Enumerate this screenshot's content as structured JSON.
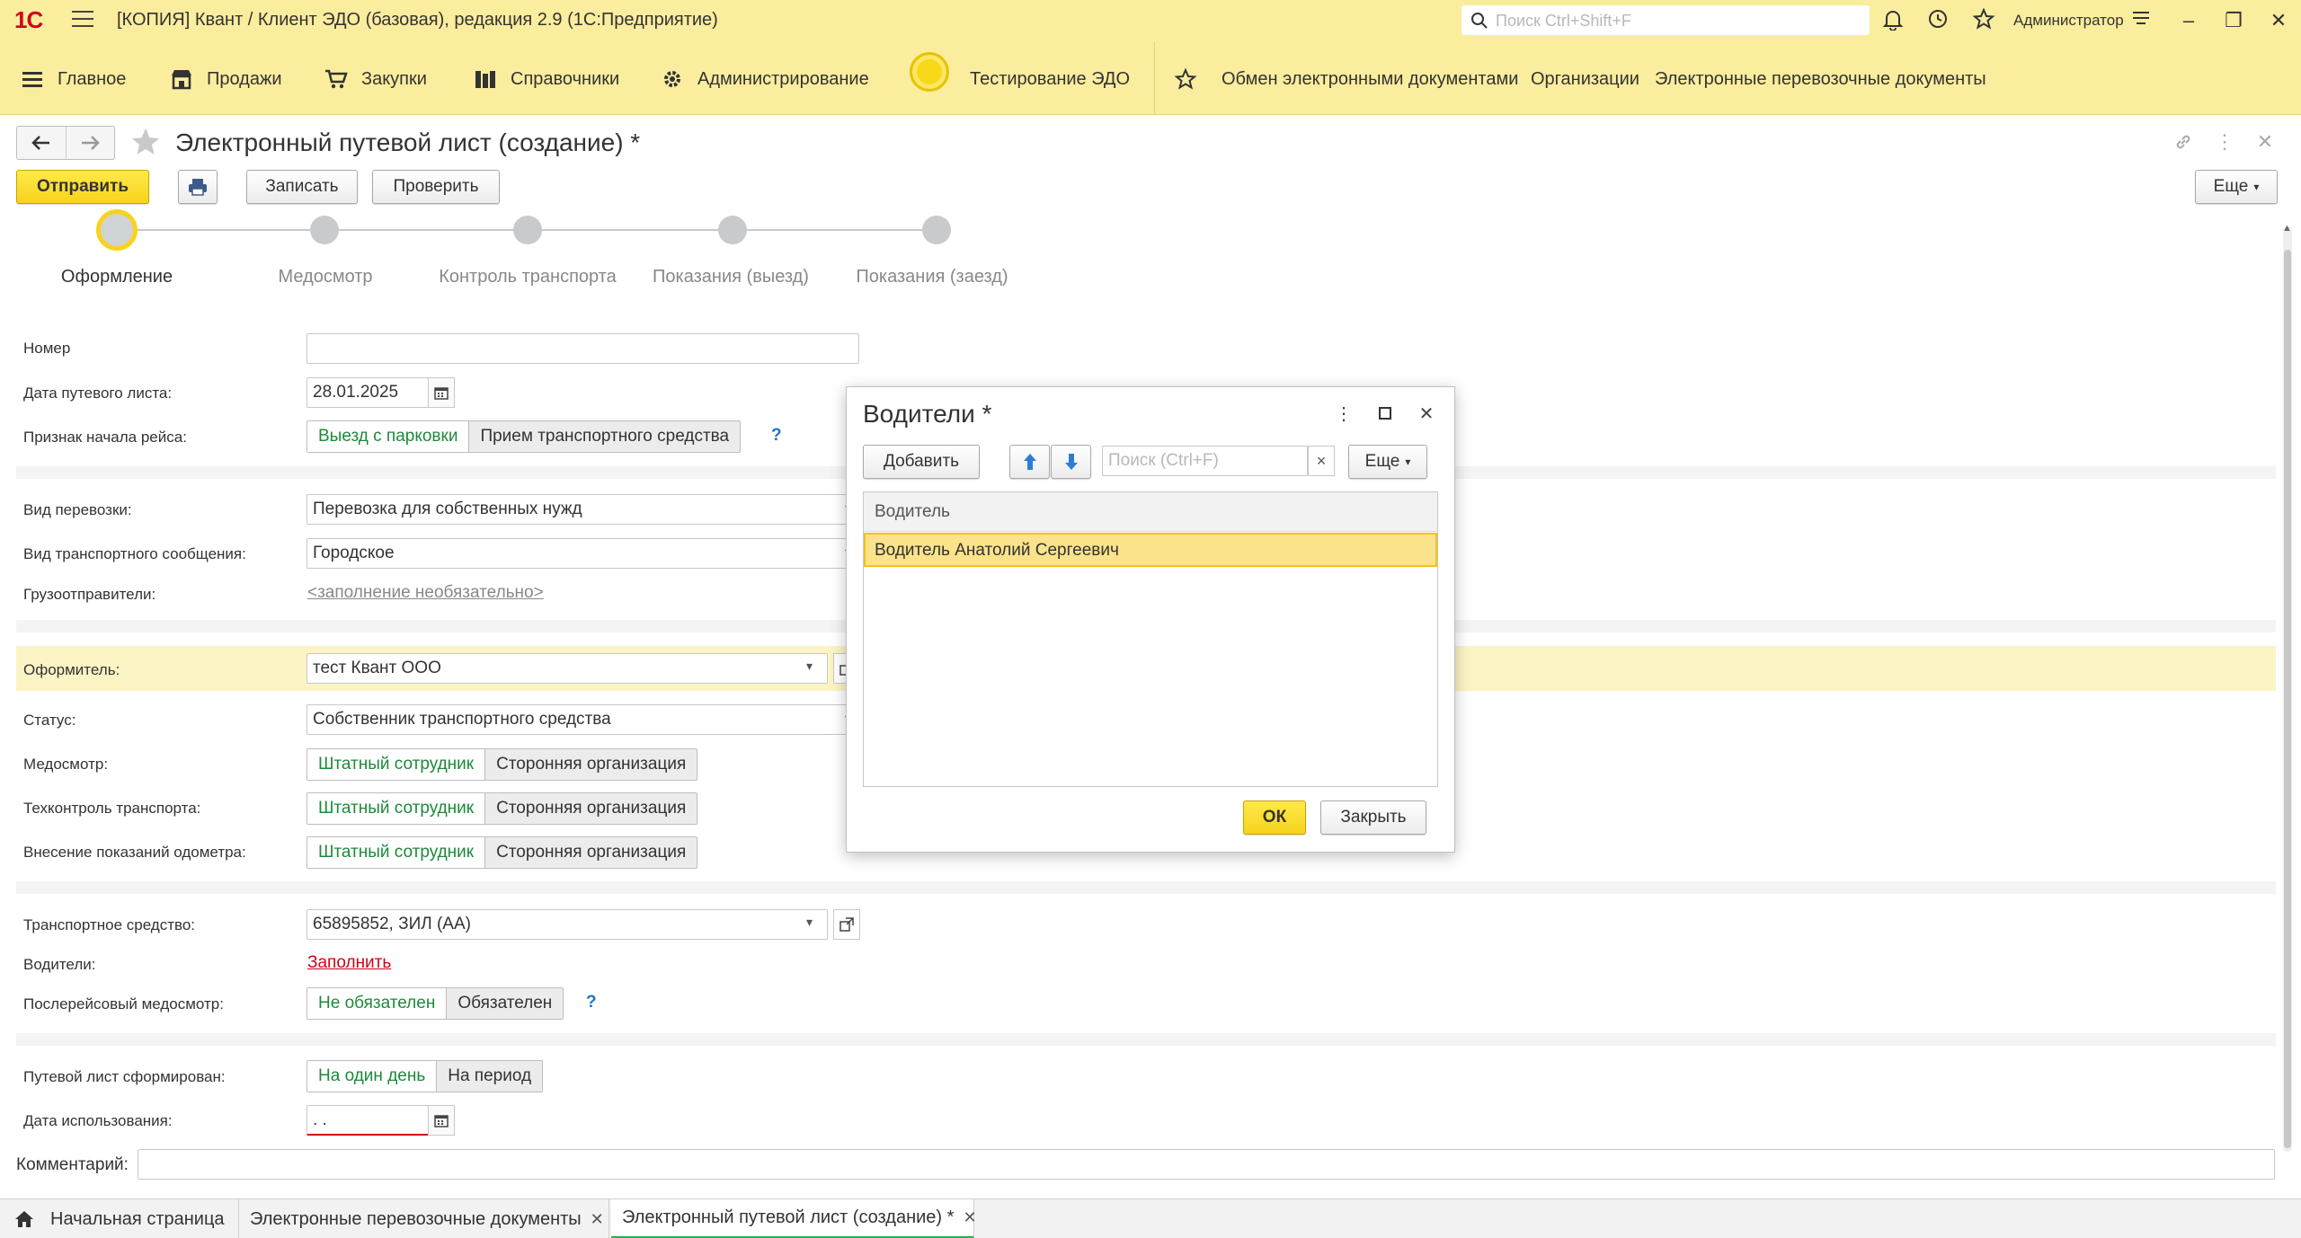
{
  "window": {
    "logo": "1C",
    "title": "[КОПИЯ] Квант / Клиент ЭДО (базовая), редакция 2.9  (1С:Предприятие)",
    "search_placeholder": "Поиск Ctrl+Shift+F",
    "user": "Администратор"
  },
  "menu": {
    "items": [
      {
        "label": "Главное",
        "icon": "hamburger-icon"
      },
      {
        "label": "Продажи",
        "icon": "shop-icon"
      },
      {
        "label": "Закупки",
        "icon": "cart-icon"
      },
      {
        "label": "Справочники",
        "icon": "books-icon"
      },
      {
        "label": "Администрирование",
        "icon": "gear-icon"
      },
      {
        "label": "Тестирование ЭДО",
        "icon": "sun-icon"
      }
    ],
    "favorites": [
      "Обмен электронными документами",
      "Организации",
      "Электронные перевозочные документы"
    ]
  },
  "form": {
    "title": "Электронный путевой лист (создание) *",
    "buttons": {
      "send": "Отправить",
      "save": "Записать",
      "check": "Проверить",
      "more": "Еще"
    },
    "steps": [
      {
        "label": "Оформление",
        "active": true
      },
      {
        "label": "Медосмотр",
        "active": false
      },
      {
        "label": "Контроль транспорта",
        "active": false
      },
      {
        "label": "Показания (выезд)",
        "active": false
      },
      {
        "label": "Показания (заезд)",
        "active": false
      }
    ],
    "fields": {
      "number_label": "Номер",
      "number_value": "",
      "date_label": "Дата путевого листа:",
      "date_value": "28.01.2025",
      "trip_start_label": "Признак начала рейса:",
      "trip_start_options": [
        "Выезд с парковки",
        "Прием транспортного средства"
      ],
      "help": "?",
      "transport_type_label": "Вид перевозки:",
      "transport_type_value": "Перевозка для собственных нужд",
      "connection_label": "Вид транспортного сообщения:",
      "connection_value": "Городское",
      "shippers_label": "Грузоотправители:",
      "shippers_link": "<заполнение необязательно>",
      "issuer_label": "Оформитель:",
      "issuer_value": "тест Квант ООО",
      "status_label": "Статус:",
      "status_value": "Собственник транспортного средства",
      "med_label": "Медосмотр:",
      "tech_label": "Техконтроль транспорта:",
      "odometer_label": "Внесение показаний одометра:",
      "staff_option": "Штатный сотрудник",
      "third_party_option": "Сторонняя организация",
      "vehicle_label": "Транспортное средство:",
      "vehicle_value": "65895852, ЗИЛ  (АА)",
      "drivers_label": "Водители:",
      "drivers_link": "Заполнить",
      "post_med_label": "Послерейсовый медосмотр:",
      "post_med_options": [
        "Не обязателен",
        "Обязателен"
      ],
      "formed_label": "Путевой лист сформирован:",
      "formed_options": [
        "На один день",
        "На период"
      ],
      "use_date_label": "Дата использования:",
      "use_date_value": " .  .",
      "comment_label": "Комментарий:",
      "comment_value": ""
    }
  },
  "modal": {
    "title": "Водители *",
    "add": "Добавить",
    "search_placeholder": "Поиск (Ctrl+F)",
    "clear": "×",
    "more": "Еще",
    "column": "Водитель",
    "rows": [
      "Водитель Анатолий Сергеевич"
    ],
    "ok": "ОК",
    "close": "Закрыть"
  },
  "tabs": [
    {
      "label": "Начальная страница",
      "closable": false
    },
    {
      "label": "Электронные перевозочные документы",
      "closable": true
    },
    {
      "label": "Электронный путевой лист (создание) *",
      "closable": true,
      "active": true
    }
  ],
  "colors": {
    "accent": "#f7d31b",
    "panel": "#fbed9e",
    "link_red": "#d0021b",
    "toggle_on": "#1d8a3a"
  }
}
